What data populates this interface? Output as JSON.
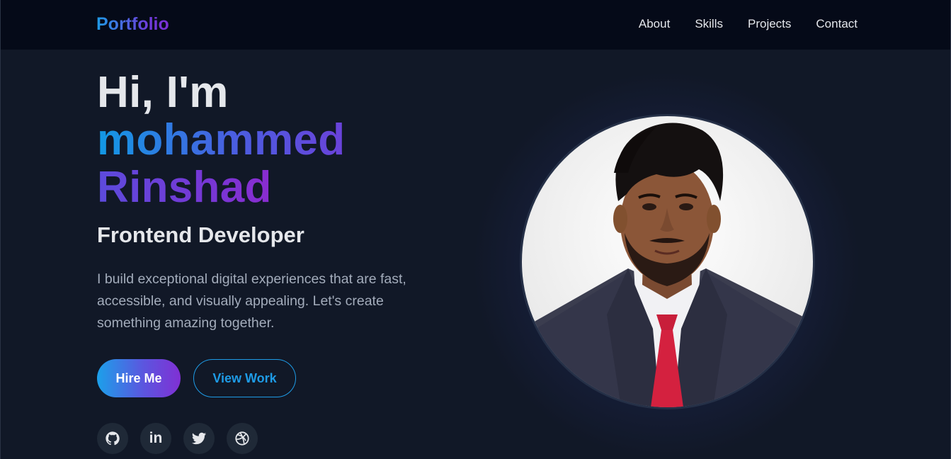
{
  "nav": {
    "logo": "Portfolio",
    "links": [
      "About",
      "Skills",
      "Projects",
      "Contact"
    ]
  },
  "hero": {
    "greeting": "Hi, I'm",
    "first_name": "mohammed",
    "last_name": "Rinshad",
    "role": "Frontend Developer",
    "bio": "I build exceptional digital experiences that are fast, accessible, and visually appealing. Let's create something amazing together.",
    "primary_button": "Hire Me",
    "secondary_button": "View Work"
  },
  "social": {
    "icons": [
      "github-icon",
      "linkedin-icon",
      "twitter-icon",
      "dribbble-icon"
    ],
    "linkedin_label": "in"
  },
  "colors": {
    "background": "#111827",
    "navbar": "#050a18",
    "accent_blue": "#1e9be6",
    "accent_purple": "#7b2fd3",
    "text_primary": "#e5e7eb",
    "text_muted": "#a3acbb"
  }
}
